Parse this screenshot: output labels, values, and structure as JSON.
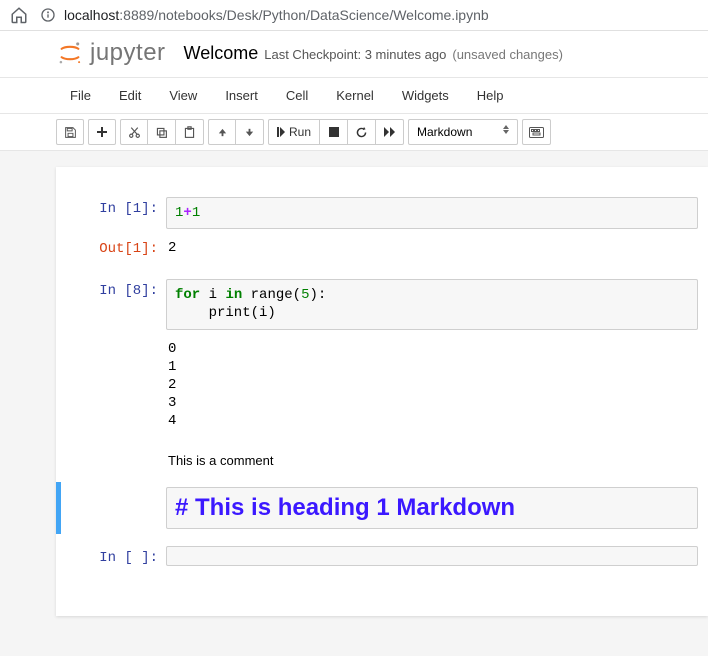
{
  "browser": {
    "url_host": "localhost",
    "url_path": ":8889/notebooks/Desk/Python/DataScience/Welcome.ipynb"
  },
  "header": {
    "logo_text": "jupyter",
    "title": "Welcome",
    "checkpoint": "Last Checkpoint: 3 minutes ago",
    "unsaved": "(unsaved changes)"
  },
  "menu": {
    "file": "File",
    "edit": "Edit",
    "view": "View",
    "insert": "Insert",
    "cell": "Cell",
    "kernel": "Kernel",
    "widgets": "Widgets",
    "help": "Help"
  },
  "toolbar": {
    "run_label": "Run",
    "cell_type": "Markdown"
  },
  "cells": {
    "c1": {
      "in_prompt": "In [1]:",
      "out_prompt": "Out[1]:",
      "code_a": "1",
      "code_op": "+",
      "code_b": "1",
      "output": "2"
    },
    "c2": {
      "in_prompt": "In [8]:",
      "kw_for": "for",
      "var_i": " i ",
      "kw_in": "in",
      "fn_range": " range",
      "paren_o": "(",
      "arg5": "5",
      "paren_c": "):",
      "line2": "    print(i)",
      "output": "0\n1\n2\n3\n4"
    },
    "c3": {
      "text": "This is a comment"
    },
    "c4": {
      "md": "# This is heading 1 Markdown"
    },
    "c5": {
      "in_prompt": "In [ ]:"
    }
  }
}
